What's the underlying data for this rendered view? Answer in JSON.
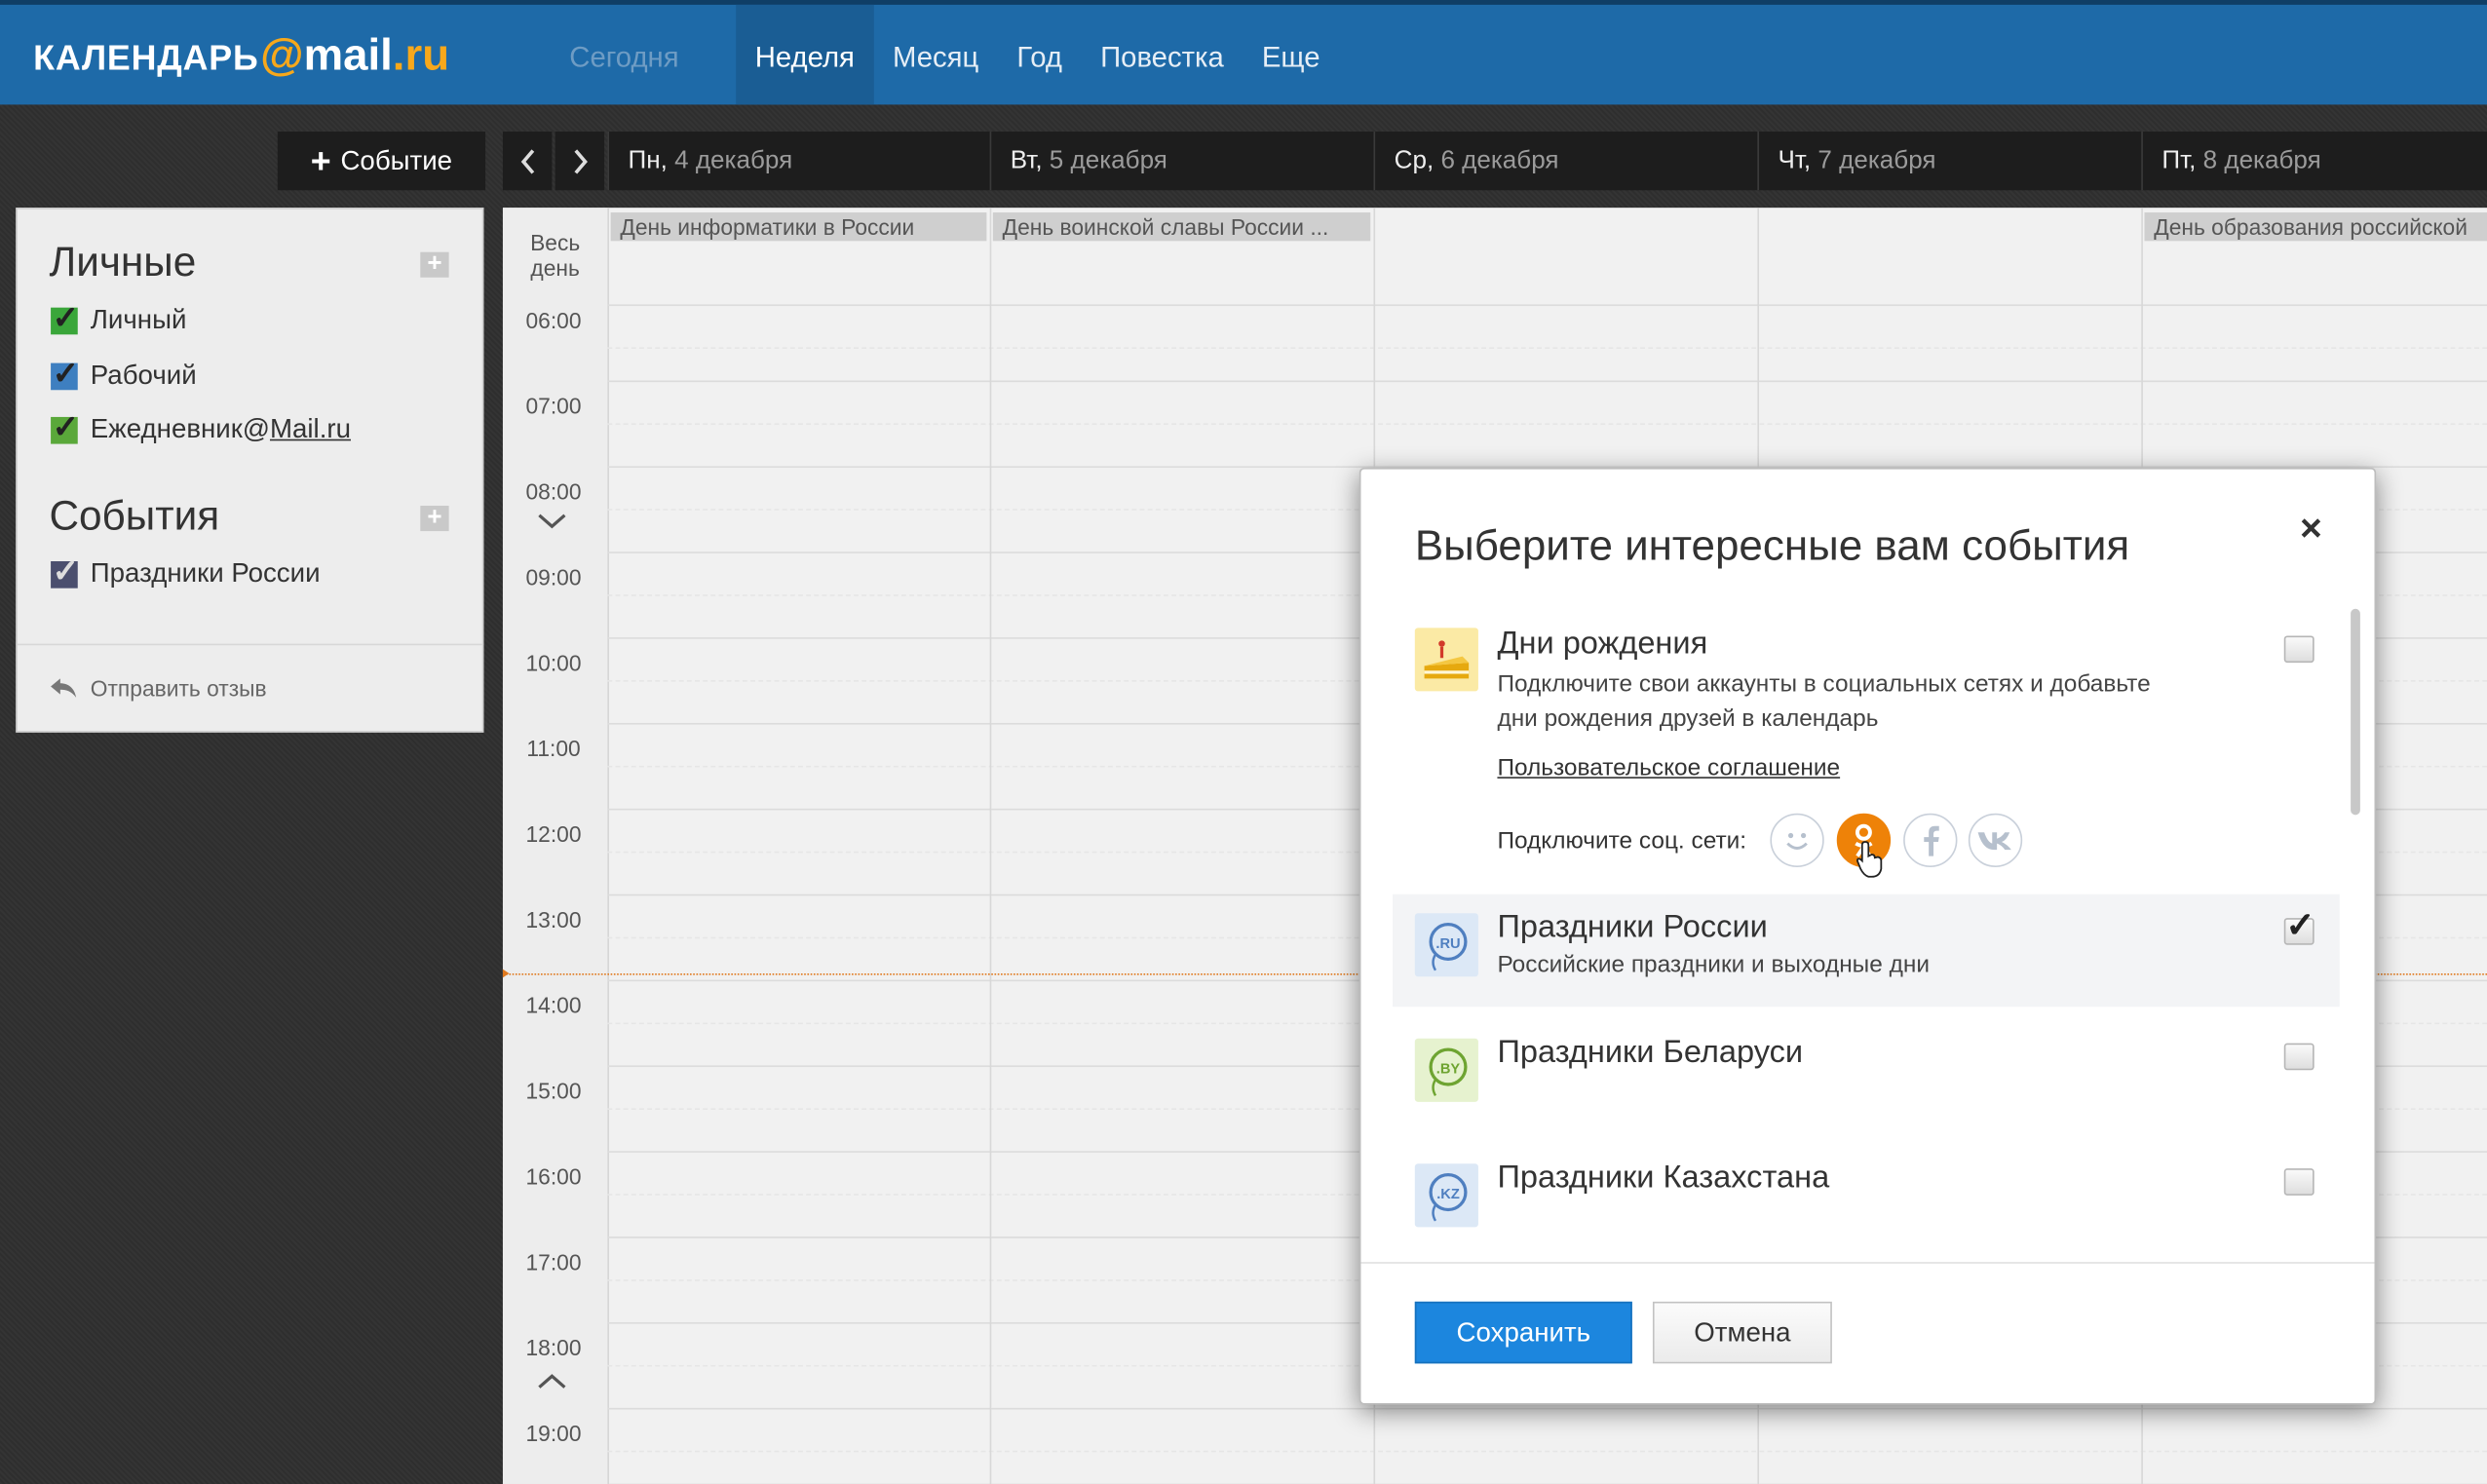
{
  "header": {
    "logo_brand": "КАЛЕНДАРЬ",
    "logo_at": "@",
    "logo_mail": "mail",
    "logo_ru": ".ru",
    "nav": [
      {
        "label": "Сегодня",
        "state": "disabled"
      },
      {
        "label": "Неделя",
        "state": "active"
      },
      {
        "label": "Месяц",
        "state": "normal"
      },
      {
        "label": "Год",
        "state": "normal"
      },
      {
        "label": "Повестка",
        "state": "normal"
      },
      {
        "label": "Еще",
        "state": "normal"
      }
    ]
  },
  "toolbar": {
    "new_event_label": "Событие",
    "days": [
      {
        "name": "Пн,",
        "date": "4 декабря"
      },
      {
        "name": "Вт,",
        "date": "5 декабря"
      },
      {
        "name": "Ср,",
        "date": "6 декабря"
      },
      {
        "name": "Чт,",
        "date": "7 декабря"
      },
      {
        "name": "Пт,",
        "date": "8 декабря"
      }
    ]
  },
  "sidebar": {
    "personal_title": "Личные",
    "calendars": [
      {
        "label": "Личный",
        "color": "#3aa63a",
        "checked": true
      },
      {
        "label": "Рабочий",
        "color": "#3e7fc0",
        "checked": true
      },
      {
        "label_prefix": "Ежедневник@",
        "label_link": "Mail.ru",
        "color": "#5aa83a",
        "checked": true
      }
    ],
    "events_title": "События",
    "event_calendars": [
      {
        "label": "Праздники России",
        "color": "#4b4f6e",
        "checked": true
      }
    ],
    "feedback_label": "Отправить отзыв"
  },
  "grid": {
    "allday_label_1": "Весь",
    "allday_label_2": "день",
    "times": [
      "06:00",
      "07:00",
      "08:00",
      "09:00",
      "10:00",
      "11:00",
      "12:00",
      "13:00",
      "14:00",
      "15:00",
      "16:00",
      "17:00",
      "18:00",
      "19:00"
    ],
    "allday_events": [
      {
        "day": 0,
        "title": "День информатики в России"
      },
      {
        "day": 1,
        "title": "День воинской славы России ..."
      },
      {
        "day": 4,
        "title": "День образования российской"
      }
    ]
  },
  "modal": {
    "title": "Выберите интересные вам события",
    "close_symbol": "×",
    "items": [
      {
        "title": "Дни рождения",
        "desc_line1": "Подключите свои аккаунты в социальных сетях и добавьте",
        "desc_line2": "дни рождения друзей в календарь",
        "agreement_link": "Пользовательское соглашение",
        "social_label": "Подключите соц. сети:",
        "social_icons": [
          "moimir-icon",
          "odnoklassniki-icon",
          "facebook-icon",
          "vk-icon"
        ],
        "checked": false
      },
      {
        "title": "Праздники России",
        "desc": "Российские праздники и выходные дни",
        "badge": ".RU",
        "checked": true
      },
      {
        "title": "Праздники Беларуси",
        "badge": ".BY",
        "checked": false
      },
      {
        "title": "Праздники Казахстана",
        "badge": ".KZ",
        "checked": false
      }
    ],
    "save_label": "Сохранить",
    "cancel_label": "Отмена",
    "colors": {
      "primary": "#1c86de",
      "ok_orange": "#ee8208"
    }
  }
}
